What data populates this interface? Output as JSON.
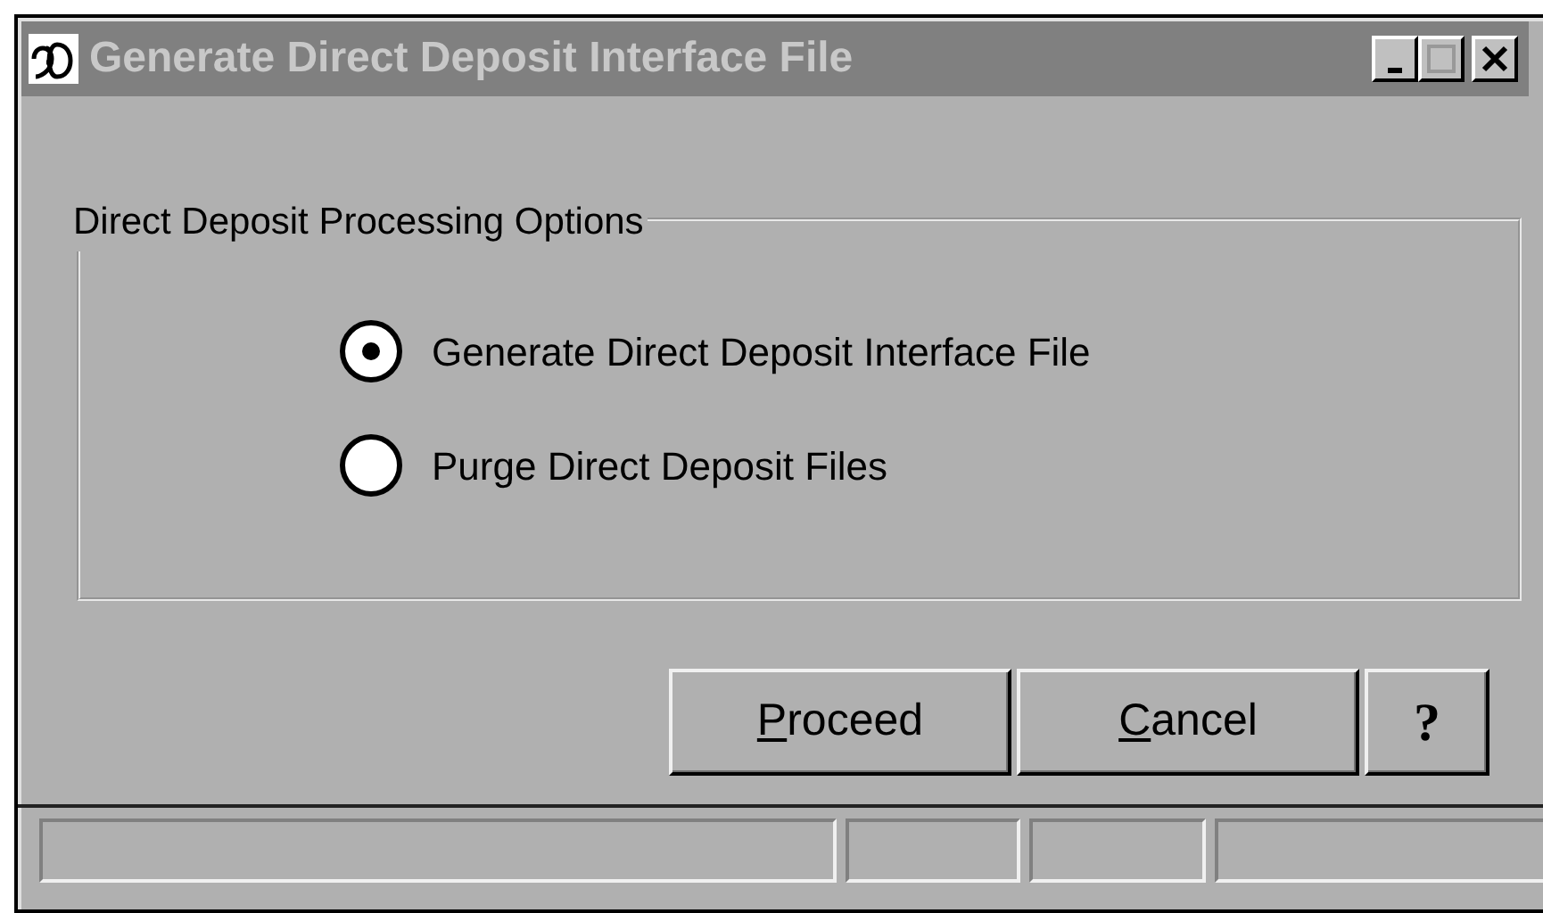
{
  "window": {
    "title": "Generate Direct Deposit Interface File"
  },
  "group": {
    "label": "Direct Deposit Processing Options",
    "options": [
      {
        "label": "Generate Direct Deposit Interface File",
        "selected": true
      },
      {
        "label": "Purge Direct Deposit Files",
        "selected": false
      }
    ]
  },
  "buttons": [
    {
      "kind": "text",
      "accel": "P",
      "rest": "roceed"
    },
    {
      "kind": "text",
      "accel": "C",
      "rest": "ancel"
    },
    {
      "kind": "help",
      "rest": "?"
    }
  ]
}
